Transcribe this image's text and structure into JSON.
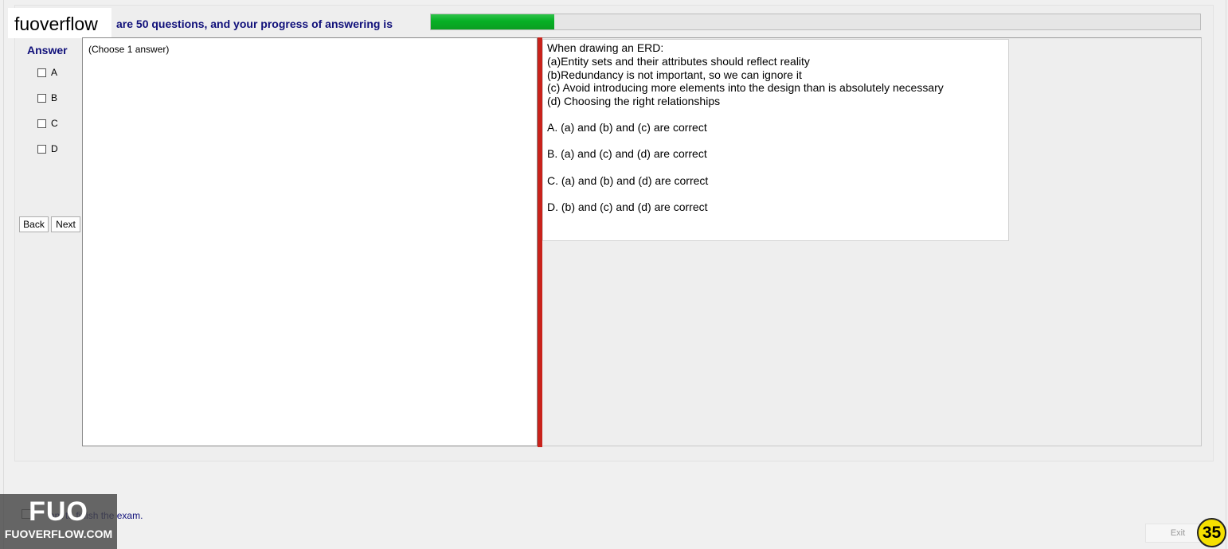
{
  "header": {
    "progress_text": "are 50 questions, and your progress of answering is",
    "progress_fraction": 0.16
  },
  "logo": {
    "text": "fuoverflow"
  },
  "answer_panel": {
    "title": "Answer",
    "options": [
      "A",
      "B",
      "C",
      "D"
    ],
    "back_label": "Back",
    "next_label": "Next"
  },
  "left_pane": {
    "hint": "(Choose 1 answer)"
  },
  "question": {
    "lines": [
      "When drawing an ERD:",
      "(a)Entity sets and their attributes should reflect reality",
      "(b)Redundancy is not important, so we can ignore it",
      "(c) Avoid introducing more elements into the design than is absolutely necessary",
      "(d) Choosing the right relationships"
    ],
    "choices": [
      "A.  (a) and (b) and (c) are correct",
      "B.  (a) and (c) and (d) are correct",
      "C.  (a) and (b) and (d) are correct",
      "D.  (b) and (c) and (d) are correct"
    ]
  },
  "footer": {
    "finish_text": "ant to finish the exam.",
    "exit_label": "Exit",
    "page_number": "35"
  },
  "watermark": {
    "big": "FUO",
    "small": "FUOVERFLOW.COM"
  },
  "colors": {
    "accent_text": "#10107a",
    "progress": "#06b025",
    "splitter": "#c8221b",
    "badge": "#f6e000"
  }
}
